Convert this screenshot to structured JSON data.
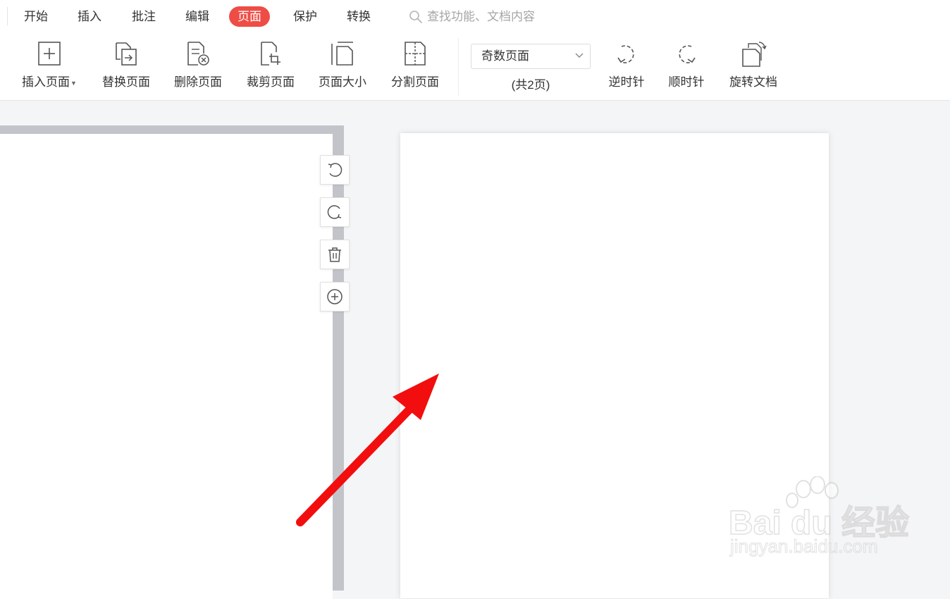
{
  "tabs": [
    {
      "label": "开始"
    },
    {
      "label": "插入"
    },
    {
      "label": "批注"
    },
    {
      "label": "编辑"
    },
    {
      "label": "页面",
      "active": true
    },
    {
      "label": "保护"
    },
    {
      "label": "转换"
    }
  ],
  "search": {
    "placeholder": "查找功能、文档内容"
  },
  "ribbon": {
    "insert_page": "插入页面",
    "replace_page": "替换页面",
    "delete_page": "删除页面",
    "crop_page": "裁剪页面",
    "page_size": "页面大小",
    "split_page": "分割页面",
    "page_range_selected": "奇数页面",
    "page_count": "(共2页)",
    "rotate_ccw": "逆时针",
    "rotate_cw": "顺时针",
    "rotate_doc": "旋转文档"
  },
  "watermark": {
    "brand": "Bai du 经验",
    "url": "jingyan.baidu.com"
  },
  "colors": {
    "accent": "#ee4d46",
    "arrow": "#f20e0e"
  },
  "icons": {
    "page_side_buttons": [
      "rotate-ccw-icon",
      "rotate-cw-icon",
      "trash-icon",
      "add-circle-icon"
    ]
  }
}
